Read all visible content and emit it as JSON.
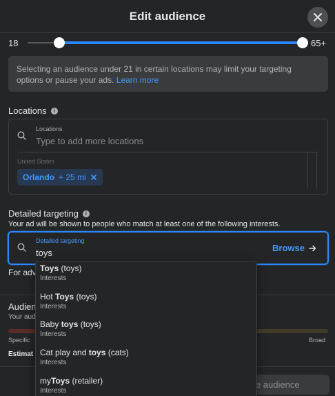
{
  "header": {
    "title": "Edit audience"
  },
  "age": {
    "min": "18",
    "max": "65+",
    "min_value": 18,
    "max_value": 65
  },
  "notice": {
    "text": "Selecting an audience under 21 in certain locations may limit your targeting options or pause your ads.",
    "link": "Learn more"
  },
  "locations": {
    "section_label": "Locations",
    "field_label": "Locations",
    "placeholder": "Type to add more locations",
    "country": "United States",
    "chip": {
      "name": "Orlando",
      "radius": "+ 25 mi"
    }
  },
  "detailed_targeting": {
    "section_label": "Detailed targeting",
    "description": "Your ad will be shown to people who match at least one of the following interests.",
    "field_label": "Detailed targeting",
    "value": "toys",
    "browse_label": "Browse"
  },
  "suggestions": [
    {
      "pre": "",
      "bold": "Toys",
      "post": " (toys)",
      "type": "Interests"
    },
    {
      "pre": "Hot ",
      "bold": "Toys",
      "post": " (toys)",
      "type": "Interests"
    },
    {
      "pre": "Baby ",
      "bold": "toys",
      "post": " (toys)",
      "type": "Interests"
    },
    {
      "pre": "Cat play and ",
      "bold": "toys",
      "post": " (cats)",
      "type": "Interests"
    },
    {
      "pre": "my",
      "bold": "Toys",
      "post": " (retailer)",
      "type": "Interests"
    }
  ],
  "background": {
    "for_adv": "For adv",
    "audience_title": "Audien",
    "audience_sub": "Your aud",
    "specific": "Specific",
    "broad": "Broad",
    "estimate": "Estimat",
    "save_label": "ve audience"
  },
  "colors": {
    "accent": "#2d88ff",
    "link": "#4599ff",
    "background": "#242526"
  }
}
